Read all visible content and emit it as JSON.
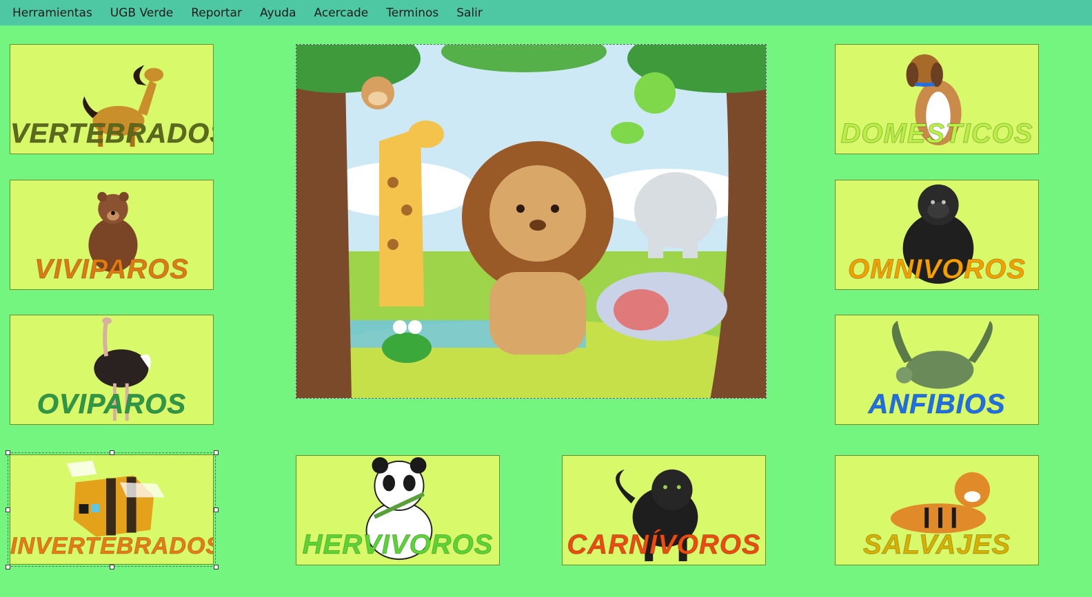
{
  "menu": [
    "Herramientas",
    "UGB Verde",
    "Reportar",
    "Ayuda",
    "Acercade",
    "Terminos",
    "Salir"
  ],
  "cards": {
    "vertebrados": {
      "label": "VERTEBRADOS",
      "icon": "horse-icon",
      "color": "#5b6a1c"
    },
    "viviparos": {
      "label": "VIVIPAROS",
      "icon": "bear-icon",
      "color": "#e07a10"
    },
    "oviparos": {
      "label": "OVIPAROS",
      "icon": "ostrich-icon",
      "color": "#2a9a4a"
    },
    "invertebrados": {
      "label": "INVERTEBRADOS",
      "icon": "bee-icon",
      "color": "#ee7a10"
    },
    "hervivoros": {
      "label": "HERVIVOROS",
      "icon": "panda-icon",
      "color": "#59d633"
    },
    "carnivoros": {
      "label": "CARNÍVOROS",
      "icon": "panther-icon",
      "color": "#f04a10"
    },
    "domesticos": {
      "label": "DOMESTICOS",
      "icon": "dog-icon",
      "color": "#b8f045"
    },
    "omnivoros": {
      "label": "OMNIVOROS",
      "icon": "gorilla-icon",
      "color": "#f6a000"
    },
    "anfibios": {
      "label": "ANFIBIOS",
      "icon": "turtle-icon",
      "color": "#1b6ff0"
    },
    "salvajes": {
      "label": "SALVAJES",
      "icon": "tiger-icon",
      "color": "#d9b000"
    }
  },
  "scene": {
    "icon": "jungle-animals-illustration"
  }
}
